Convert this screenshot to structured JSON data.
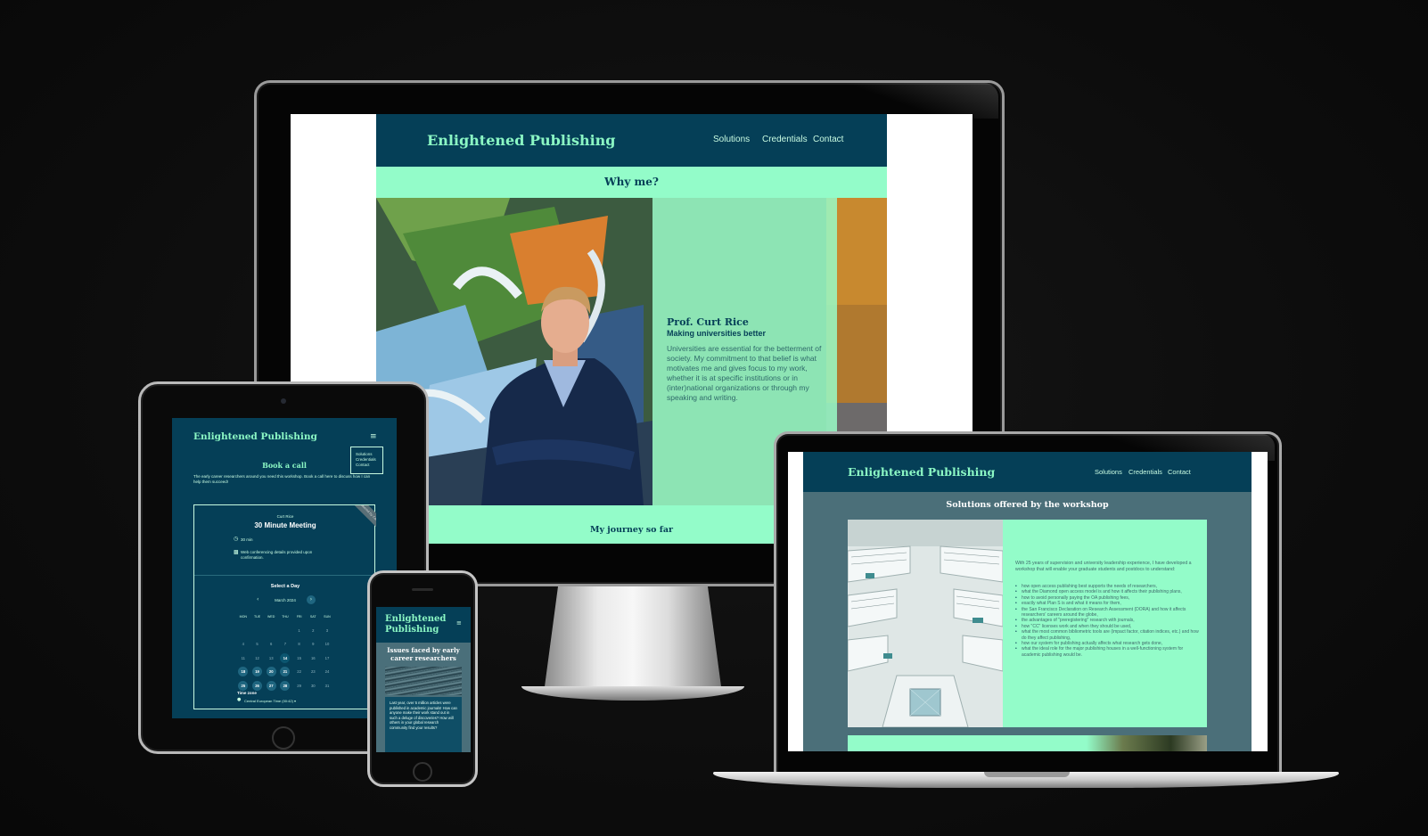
{
  "brand": {
    "name": "Enlightened Publishing",
    "accent": "#8bf7c4",
    "dark": "#053f57",
    "mint": "#93fcc9"
  },
  "nav": {
    "solutions": "Solutions",
    "credentials": "Credentials",
    "contact": "Contact"
  },
  "desktop": {
    "section_title": "Why me?",
    "name": "Prof. Curt Rice",
    "tagline": "Making universities better",
    "bio": "Universities are essential for the betterment of society. My commitment to that belief is what motivates me and gives focus to my work, whether it is at specific institutions or in (inter)national organizations or through my speaking and writing.",
    "next_section": "My journey so far"
  },
  "tablet": {
    "menu_icon": "≡",
    "page_title": "Book a call",
    "intro": "The early career researchers around you need this workshop. Book a call here to discuss how I can help them succeed!",
    "ribbon": "powered by Calendly",
    "host": "Curt Rice",
    "meeting": "30 Minute Meeting",
    "duration": "30 min",
    "conferencing": "Web conferencing details provided upon confirmation.",
    "select_day": "Select a Day",
    "month": "March 2024",
    "weekdays": [
      "MON",
      "TUE",
      "WED",
      "THU",
      "FRI",
      "SAT",
      "SUN"
    ],
    "weeks": [
      [
        "",
        "",
        "",
        "",
        "1",
        "2",
        "3"
      ],
      [
        "4",
        "5",
        "6",
        "7",
        "8",
        "9",
        "10"
      ],
      [
        "11",
        "12",
        "13",
        "14",
        "15",
        "16",
        "17"
      ],
      [
        "18",
        "19",
        "20",
        "21",
        "22",
        "23",
        "24"
      ],
      [
        "25",
        "26",
        "27",
        "28",
        "29",
        "30",
        "31"
      ]
    ],
    "available_days": [
      "18",
      "19",
      "20",
      "21",
      "25",
      "26",
      "27",
      "28"
    ],
    "today": "14",
    "timezone_label": "Time zone",
    "timezone_value": "Central European Time (00:42) ▾"
  },
  "phone": {
    "menu_icon": "≡",
    "section_title": "Issues faced by early career researchers",
    "body": "Last year, over 5 million articles were published in academic journals! How can anyone make their work stand out in such a deluge of discoveries? How will others in your global research community find your results?"
  },
  "laptop": {
    "section_title": "Solutions offered by the workshop",
    "intro": "With 25 years of supervision and university leadership experience, I have developed a workshop that will enable your graduate students and postdocs to understand:",
    "items": [
      "how open access publishing best supports the needs of researchers,",
      "what the Diamond open access model is and how it affects their publishing plans,",
      "how to avoid personally paying the OA publishing fees,",
      "exactly what Plan S is and what it means for them,",
      "the San Francisco Declaration on Research Assessment (DORA) and how it affects researchers' careers around the globe,",
      "the advantages of \"preregistering\" research with journals,",
      "how \"CC\" licenses work and when they should be used,",
      "what the most common bibliometric tools are (impact factor, citation indices, etc.) and how do they affect publishing,",
      "how our system for publishing actually affects what research gets done,",
      "what the ideal role for the major publishing houses in a well-functioning system for academic publishing would be."
    ]
  }
}
